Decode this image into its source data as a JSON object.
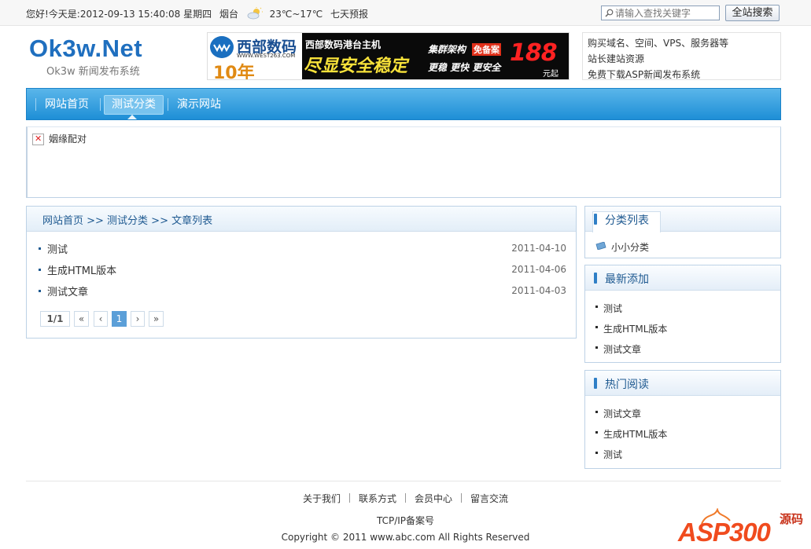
{
  "topbar": {
    "greeting": "您好!今天是:2012-09-13 15:40:08 星期四",
    "city": "烟台",
    "weather_icon": "cloud-sun-icon",
    "temperature": "23℃~17℃",
    "forecast_link": "七天预报",
    "search_placeholder": "请输入查找关键字",
    "search_button": "全站搜索"
  },
  "header": {
    "logo_text": "Ok3w.Net",
    "logo_subtitle": "Ok3w 新闻发布系统",
    "banner": {
      "brand": "西部数码",
      "url": "WWW.WEST263.COM",
      "years": "10年",
      "line1": "西部数码港台主机",
      "headline": "尽显安全稳定",
      "feature": "集群架构",
      "badge": "免备案",
      "features2": "更稳 更快 更安全",
      "price": "188",
      "price_unit": "元起"
    },
    "links": [
      "购买域名、空间、VPS、服务器等",
      "站长建站资源",
      "免费下载ASP新闻发布系统"
    ]
  },
  "nav": {
    "items": [
      "网站首页",
      "测试分类",
      "演示网站"
    ],
    "active_index": 1
  },
  "notice": {
    "text": "姻缘配对"
  },
  "main": {
    "breadcrumb": "网站首页 >> 测试分类 >> 文章列表",
    "articles": [
      {
        "title": "测试",
        "date": "2011-04-10"
      },
      {
        "title": "生成HTML版本",
        "date": "2011-04-06"
      },
      {
        "title": "测试文章",
        "date": "2011-04-03"
      }
    ],
    "pager": {
      "count": "1/1",
      "first": "«",
      "prev": "‹",
      "current": "1",
      "next": "›",
      "last": "»"
    }
  },
  "sidebar": {
    "categories": {
      "title": "分类列表",
      "items": [
        "小小分类"
      ]
    },
    "latest": {
      "title": "最新添加",
      "items": [
        "测试",
        "生成HTML版本",
        "测试文章"
      ]
    },
    "hot": {
      "title": "热门阅读",
      "items": [
        "测试文章",
        "生成HTML版本",
        "测试"
      ]
    }
  },
  "footer": {
    "links": [
      "关于我们",
      "联系方式",
      "会员中心",
      "留言交流"
    ],
    "icp": "TCP/IP备案号",
    "copyright": "Copyright © 2011 www.abc.com All Rights Reserved"
  },
  "watermark": {
    "text": "ASP300",
    "cn": "源码"
  },
  "colors": {
    "accent": "#1f8fd6",
    "link_blue": "#1f5a91",
    "pager_current": "#5b9fd8"
  }
}
